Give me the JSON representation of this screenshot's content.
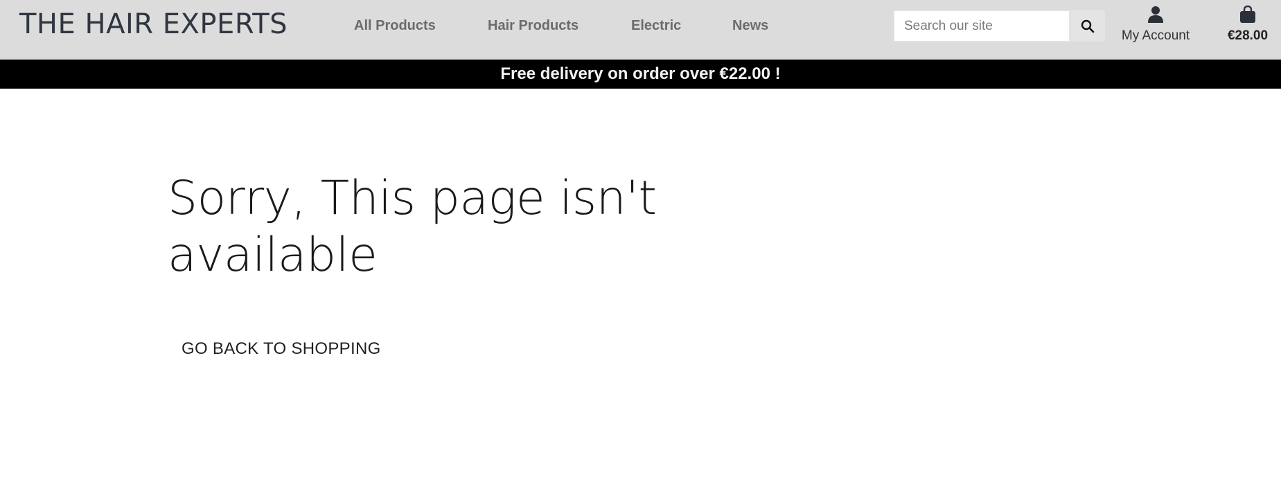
{
  "header": {
    "logo": "THE HAIR EXPERTS",
    "nav": [
      {
        "label": "All Products"
      },
      {
        "label": "Hair Products"
      },
      {
        "label": "Electric"
      },
      {
        "label": "News"
      }
    ],
    "search": {
      "placeholder": "Search our site",
      "value": "",
      "button_icon": "search-icon"
    },
    "account": {
      "icon": "user-icon",
      "label": "My Account"
    },
    "cart": {
      "icon": "shopping-bag-icon",
      "total": "€28.00"
    }
  },
  "banner": {
    "text": "Free delivery on order over €22.00 !"
  },
  "main": {
    "title_line1": "Sorry, This page isn't",
    "title_line2": "available",
    "back_button": "GO BACK TO SHOPPING"
  },
  "colors": {
    "header_bg": "#dcdcdc",
    "banner_bg": "#000000",
    "banner_text": "#f2f2f2",
    "nav_text": "#6b6b6b",
    "logo_text": "#2f3640"
  }
}
